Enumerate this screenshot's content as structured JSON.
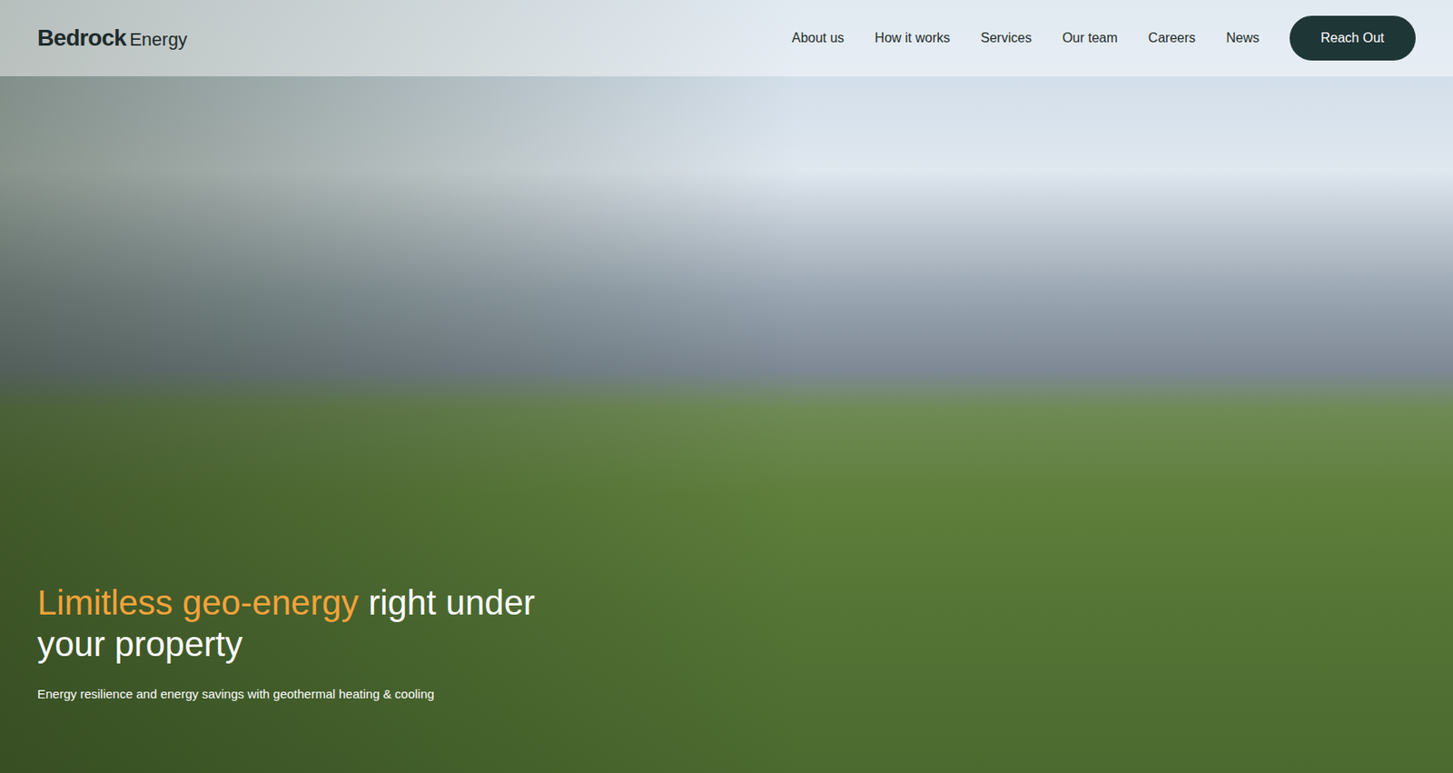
{
  "header": {
    "logo": {
      "main": "Bedrock",
      "sub": "Energy"
    },
    "nav": [
      "About us",
      "How it works",
      "Services",
      "Our team",
      "Careers",
      "News"
    ],
    "cta": "Reach Out"
  },
  "hero": {
    "headline_highlight": "Limitless geo-energy",
    "headline_rest": "right under your property",
    "subtitle": "Energy resilience and energy savings with geothermal heating & cooling"
  }
}
